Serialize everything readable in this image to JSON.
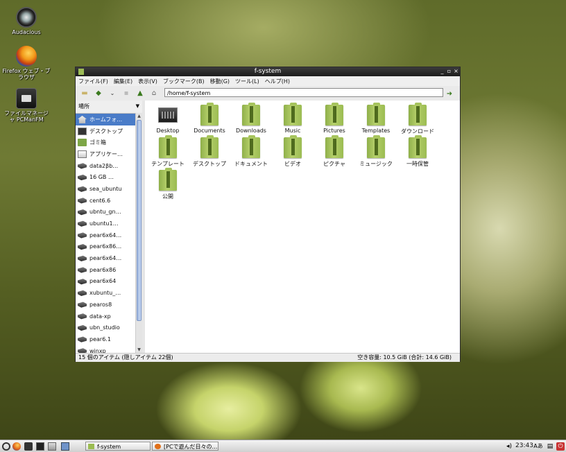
{
  "desktop": {
    "icons": [
      {
        "label": "Audacious",
        "icon": "audacious-icon"
      },
      {
        "label": "Firefox ウェブ・ブラウザ",
        "icon": "firefox-icon"
      },
      {
        "label": "ファイルマネージャ PCManFM",
        "icon": "file-manager-icon"
      }
    ]
  },
  "window": {
    "title": "f-system",
    "menu": [
      "ファイル(F)",
      "編集(E)",
      "表示(V)",
      "ブックマーク(B)",
      "移動(G)",
      "ツール(L)",
      "ヘルプ(H)"
    ],
    "path": "/home/f-system",
    "sidebar_header": "場所",
    "sidebar_items": [
      {
        "label": "ホームフォ…",
        "icon": "home-icon",
        "selected": true
      },
      {
        "label": "デスクトップ",
        "icon": "desktop-icon"
      },
      {
        "label": "ゴミ箱",
        "icon": "trash-icon"
      },
      {
        "label": "アプリケー…",
        "icon": "applications-icon"
      },
      {
        "label": "data2βb…",
        "icon": "drive-icon"
      },
      {
        "label": "16 GB …",
        "icon": "drive-icon"
      },
      {
        "label": "sea_ubuntu",
        "icon": "drive-icon"
      },
      {
        "label": "cent6.6",
        "icon": "drive-icon"
      },
      {
        "label": "ubntu_gn…",
        "icon": "drive-icon"
      },
      {
        "label": "ubuntu1…",
        "icon": "drive-icon"
      },
      {
        "label": "pear6x64…",
        "icon": "drive-icon"
      },
      {
        "label": "pear6x86…",
        "icon": "drive-icon"
      },
      {
        "label": "pear6x64…",
        "icon": "drive-icon"
      },
      {
        "label": "pear6x86",
        "icon": "drive-icon"
      },
      {
        "label": "pear6x64",
        "icon": "drive-icon"
      },
      {
        "label": "xubuntu_…",
        "icon": "drive-icon"
      },
      {
        "label": "pearos8",
        "icon": "drive-icon"
      },
      {
        "label": "data-xp",
        "icon": "drive-icon"
      },
      {
        "label": "ubn_studio",
        "icon": "drive-icon"
      },
      {
        "label": "pear6.1",
        "icon": "drive-icon"
      },
      {
        "label": "winxp",
        "icon": "drive-icon"
      }
    ],
    "files": [
      {
        "label": "Desktop",
        "type": "desktop"
      },
      {
        "label": "Documents",
        "type": "folder"
      },
      {
        "label": "Downloads",
        "type": "folder"
      },
      {
        "label": "Music",
        "type": "folder"
      },
      {
        "label": "Pictures",
        "type": "folder"
      },
      {
        "label": "Templates",
        "type": "folder"
      },
      {
        "label": "ダウンロード",
        "type": "folder"
      },
      {
        "label": "テンプレート",
        "type": "folder"
      },
      {
        "label": "デスクトップ",
        "type": "folder"
      },
      {
        "label": "ドキュメント",
        "type": "folder"
      },
      {
        "label": "ビデオ",
        "type": "folder"
      },
      {
        "label": "ピクチャ",
        "type": "folder"
      },
      {
        "label": "ミュージック",
        "type": "folder"
      },
      {
        "label": "一時保管",
        "type": "folder"
      },
      {
        "label": "公開",
        "type": "folder"
      }
    ],
    "status_left": "15 個のアイテム (隠しアイテム 22個)",
    "status_right": "空き容量: 10.5 GiB (合計: 14.6 GiB)"
  },
  "taskbar": {
    "tasks": [
      {
        "label": "f-system",
        "icon": "folder-icon"
      },
      {
        "label": "[PCで遊んだ日々の…",
        "icon": "firefox-icon"
      }
    ],
    "clock": "23:43",
    "ime": "Aあ"
  },
  "colors": {
    "accent": "#4a7cc8",
    "folder": "#9bbc52",
    "titlebar": "#2a2a2a"
  }
}
